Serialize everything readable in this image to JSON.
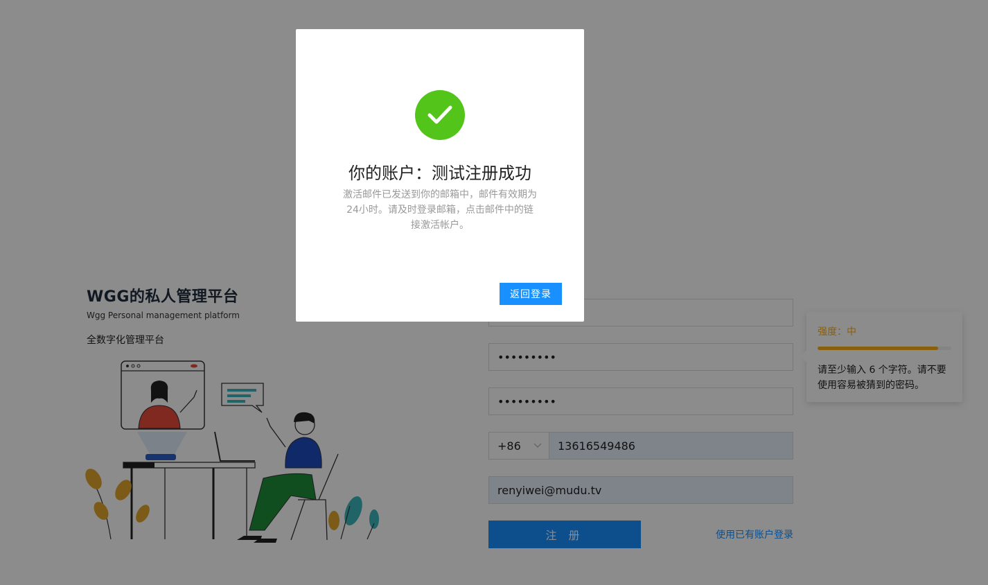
{
  "brand": {
    "title": "WGG的私人管理平台",
    "subtitle": "Wgg Personal management platform",
    "slogan": "全数字化管理平台"
  },
  "form": {
    "username_value": "",
    "password_value": "•••••••••",
    "confirm_password_value": "•••••••••",
    "country_code": "+86",
    "phone_value": "13616549486",
    "email_value": "renyiwei@mudu.tv",
    "register_label": "注 册",
    "login_link": "使用已有账户登录"
  },
  "password_tooltip": {
    "strength_label": "强度：中",
    "strength_level": 0.9,
    "tip": "请至少输入 6 个字符。请不要使用容易被猜到的密码。"
  },
  "modal": {
    "title": "你的账户：测试注册成功",
    "description": "激活邮件已发送到你的邮箱中，邮件有效期为24小时。请及时登录邮箱，点击邮件中的链接激活帐户。",
    "back_button": "返回登录"
  },
  "colors": {
    "primary": "#1890ff",
    "success": "#52c41a",
    "warning": "#faad14"
  },
  "icons": {
    "success": "check-circle-icon",
    "dropdown": "chevron-down-icon"
  }
}
